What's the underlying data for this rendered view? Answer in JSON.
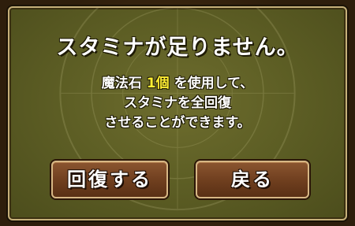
{
  "dialog": {
    "title": "スタミナが足りません。",
    "message": {
      "item_name": "魔法石",
      "cost": "1個",
      "line1_suffix": "を使用して、",
      "line2": "スタミナを全回復",
      "line3": "させることができます。"
    },
    "buttons": {
      "recover_label": "回復する",
      "back_label": "戻る"
    }
  },
  "colors": {
    "panel_green": "#5e5f25",
    "button_brown": "#6e3e1e",
    "highlight_yellow": "#ffee33",
    "text_white": "#ffffff"
  }
}
